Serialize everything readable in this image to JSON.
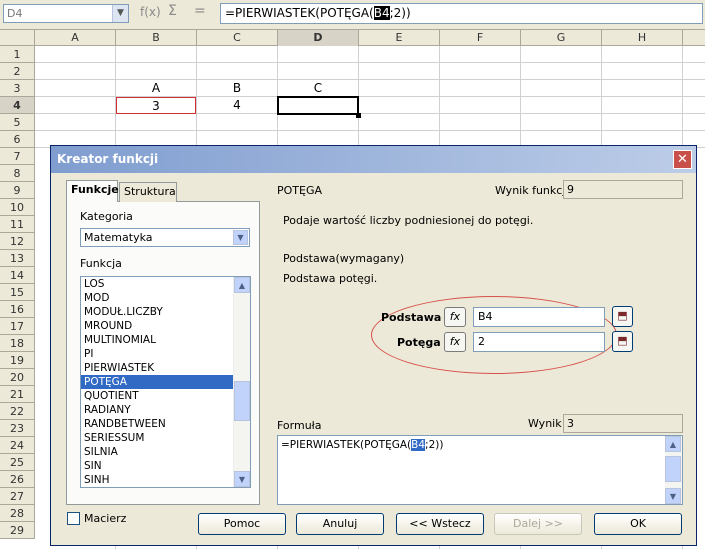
{
  "formula_bar": {
    "name_box": "D4",
    "name_dropdown": "▼",
    "func_icon": "f(x)",
    "sum_icon": "Σ",
    "equals_icon": "=",
    "formula_pre": "=PIERWIASTEK(POTĘGA(",
    "formula_hl": "B4",
    "formula_post": ";2))"
  },
  "sheet": {
    "columns": [
      "A",
      "B",
      "C",
      "D",
      "E",
      "F",
      "G",
      "H"
    ],
    "rows": [
      "1",
      "2",
      "3",
      "4",
      "5",
      "6",
      "7",
      "8",
      "9",
      "10",
      "11",
      "12",
      "13",
      "14",
      "15",
      "16",
      "17",
      "18",
      "19",
      "20",
      "21",
      "22",
      "23",
      "24",
      "25",
      "26",
      "27",
      "28",
      "29"
    ],
    "selected_column": "D",
    "selected_row": "4",
    "cells": {
      "B3": "A",
      "C3": "B",
      "D3": "C",
      "B4": "3",
      "C4": "4"
    }
  },
  "dialog": {
    "title": "Kreator funkcji",
    "close": "✕",
    "tabs": [
      "Funkcje",
      "Struktura"
    ],
    "category_label": "Kategoria",
    "category_value": "Matematyka",
    "function_label": "Funkcja",
    "functions": [
      "LOS",
      "MOD",
      "MODUŁ.LICZBY",
      "MROUND",
      "MULTINOMIAL",
      "PI",
      "PIERWIASTEK",
      "POTĘGA",
      "QUOTIENT",
      "RADIANY",
      "RANDBETWEEN",
      "SERIESSUM",
      "SILNIA",
      "SIN",
      "SINH"
    ],
    "selected_function": "POTĘGA",
    "func_name": "POTĘGA",
    "result_label": "Wynik funkcji",
    "result_value": "9",
    "description": "Podaje wartość liczby podniesionej do potęgi.",
    "param_required": "Podstawa(wymagany)",
    "param_description": "Podstawa potęgi.",
    "args": [
      {
        "label": "Podstawa",
        "value": "B4"
      },
      {
        "label": "Potęga",
        "value": "2"
      }
    ],
    "fx_label": "fx",
    "formula_label": "Formuła",
    "wynik_label": "Wynik",
    "wynik_value": "3",
    "formula_pre": "=PIERWIASTEK(POTĘGA(",
    "formula_hl": "B4",
    "formula_post": ";2))",
    "matrix_label": "Macierz",
    "buttons": {
      "help": "Pomoc",
      "cancel": "Anuluj",
      "back": "<< Wstecz",
      "next": "Dalej >>",
      "ok": "OK"
    }
  },
  "colors": {
    "accent": "#316ac5",
    "annotation": "#d8504a",
    "title_bar": "#7f9dcf"
  }
}
